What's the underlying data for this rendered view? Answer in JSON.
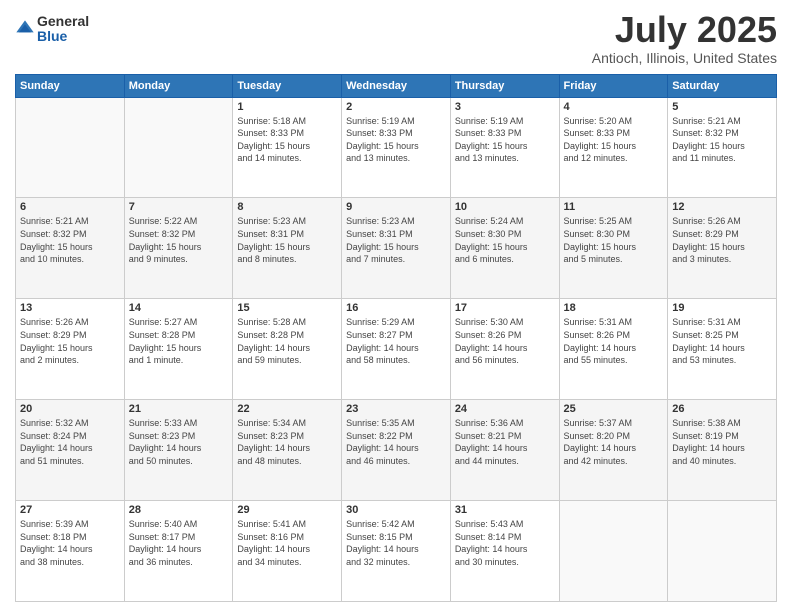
{
  "header": {
    "logo": {
      "general": "General",
      "blue": "Blue"
    },
    "title": "July 2025",
    "subtitle": "Antioch, Illinois, United States"
  },
  "weekdays": [
    "Sunday",
    "Monday",
    "Tuesday",
    "Wednesday",
    "Thursday",
    "Friday",
    "Saturday"
  ],
  "weeks": [
    [
      {
        "day": "",
        "info": ""
      },
      {
        "day": "",
        "info": ""
      },
      {
        "day": "1",
        "info": "Sunrise: 5:18 AM\nSunset: 8:33 PM\nDaylight: 15 hours\nand 14 minutes."
      },
      {
        "day": "2",
        "info": "Sunrise: 5:19 AM\nSunset: 8:33 PM\nDaylight: 15 hours\nand 13 minutes."
      },
      {
        "day": "3",
        "info": "Sunrise: 5:19 AM\nSunset: 8:33 PM\nDaylight: 15 hours\nand 13 minutes."
      },
      {
        "day": "4",
        "info": "Sunrise: 5:20 AM\nSunset: 8:33 PM\nDaylight: 15 hours\nand 12 minutes."
      },
      {
        "day": "5",
        "info": "Sunrise: 5:21 AM\nSunset: 8:32 PM\nDaylight: 15 hours\nand 11 minutes."
      }
    ],
    [
      {
        "day": "6",
        "info": "Sunrise: 5:21 AM\nSunset: 8:32 PM\nDaylight: 15 hours\nand 10 minutes."
      },
      {
        "day": "7",
        "info": "Sunrise: 5:22 AM\nSunset: 8:32 PM\nDaylight: 15 hours\nand 9 minutes."
      },
      {
        "day": "8",
        "info": "Sunrise: 5:23 AM\nSunset: 8:31 PM\nDaylight: 15 hours\nand 8 minutes."
      },
      {
        "day": "9",
        "info": "Sunrise: 5:23 AM\nSunset: 8:31 PM\nDaylight: 15 hours\nand 7 minutes."
      },
      {
        "day": "10",
        "info": "Sunrise: 5:24 AM\nSunset: 8:30 PM\nDaylight: 15 hours\nand 6 minutes."
      },
      {
        "day": "11",
        "info": "Sunrise: 5:25 AM\nSunset: 8:30 PM\nDaylight: 15 hours\nand 5 minutes."
      },
      {
        "day": "12",
        "info": "Sunrise: 5:26 AM\nSunset: 8:29 PM\nDaylight: 15 hours\nand 3 minutes."
      }
    ],
    [
      {
        "day": "13",
        "info": "Sunrise: 5:26 AM\nSunset: 8:29 PM\nDaylight: 15 hours\nand 2 minutes."
      },
      {
        "day": "14",
        "info": "Sunrise: 5:27 AM\nSunset: 8:28 PM\nDaylight: 15 hours\nand 1 minute."
      },
      {
        "day": "15",
        "info": "Sunrise: 5:28 AM\nSunset: 8:28 PM\nDaylight: 14 hours\nand 59 minutes."
      },
      {
        "day": "16",
        "info": "Sunrise: 5:29 AM\nSunset: 8:27 PM\nDaylight: 14 hours\nand 58 minutes."
      },
      {
        "day": "17",
        "info": "Sunrise: 5:30 AM\nSunset: 8:26 PM\nDaylight: 14 hours\nand 56 minutes."
      },
      {
        "day": "18",
        "info": "Sunrise: 5:31 AM\nSunset: 8:26 PM\nDaylight: 14 hours\nand 55 minutes."
      },
      {
        "day": "19",
        "info": "Sunrise: 5:31 AM\nSunset: 8:25 PM\nDaylight: 14 hours\nand 53 minutes."
      }
    ],
    [
      {
        "day": "20",
        "info": "Sunrise: 5:32 AM\nSunset: 8:24 PM\nDaylight: 14 hours\nand 51 minutes."
      },
      {
        "day": "21",
        "info": "Sunrise: 5:33 AM\nSunset: 8:23 PM\nDaylight: 14 hours\nand 50 minutes."
      },
      {
        "day": "22",
        "info": "Sunrise: 5:34 AM\nSunset: 8:23 PM\nDaylight: 14 hours\nand 48 minutes."
      },
      {
        "day": "23",
        "info": "Sunrise: 5:35 AM\nSunset: 8:22 PM\nDaylight: 14 hours\nand 46 minutes."
      },
      {
        "day": "24",
        "info": "Sunrise: 5:36 AM\nSunset: 8:21 PM\nDaylight: 14 hours\nand 44 minutes."
      },
      {
        "day": "25",
        "info": "Sunrise: 5:37 AM\nSunset: 8:20 PM\nDaylight: 14 hours\nand 42 minutes."
      },
      {
        "day": "26",
        "info": "Sunrise: 5:38 AM\nSunset: 8:19 PM\nDaylight: 14 hours\nand 40 minutes."
      }
    ],
    [
      {
        "day": "27",
        "info": "Sunrise: 5:39 AM\nSunset: 8:18 PM\nDaylight: 14 hours\nand 38 minutes."
      },
      {
        "day": "28",
        "info": "Sunrise: 5:40 AM\nSunset: 8:17 PM\nDaylight: 14 hours\nand 36 minutes."
      },
      {
        "day": "29",
        "info": "Sunrise: 5:41 AM\nSunset: 8:16 PM\nDaylight: 14 hours\nand 34 minutes."
      },
      {
        "day": "30",
        "info": "Sunrise: 5:42 AM\nSunset: 8:15 PM\nDaylight: 14 hours\nand 32 minutes."
      },
      {
        "day": "31",
        "info": "Sunrise: 5:43 AM\nSunset: 8:14 PM\nDaylight: 14 hours\nand 30 minutes."
      },
      {
        "day": "",
        "info": ""
      },
      {
        "day": "",
        "info": ""
      }
    ]
  ]
}
